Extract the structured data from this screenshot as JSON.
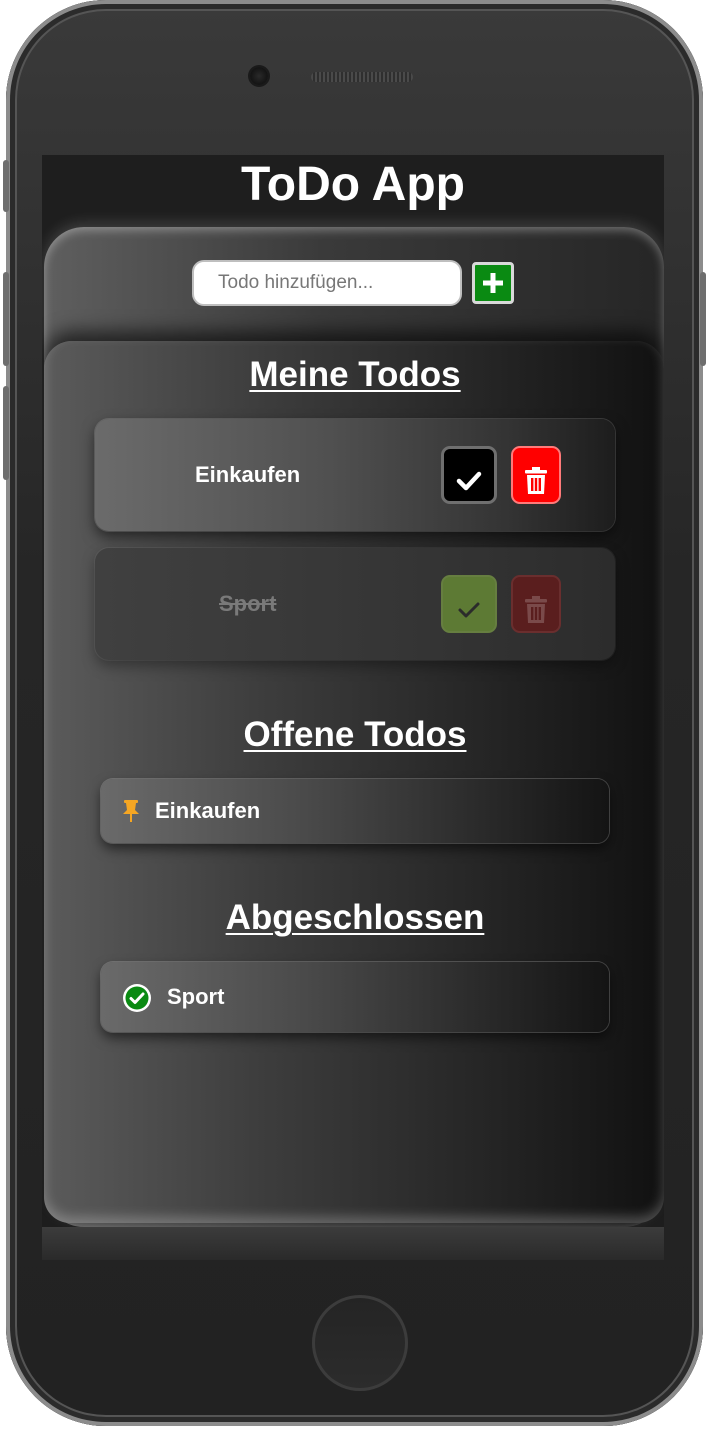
{
  "app": {
    "title": "ToDo App"
  },
  "add_form": {
    "input_value": "",
    "input_placeholder": "Todo hinzufügen...",
    "add_button_icon": "plus-icon",
    "add_button_color": "#0a8a12"
  },
  "sections": {
    "my_todos_title": "Meine Todos",
    "open_todos_title": "Offene Todos",
    "completed_title": "Abgeschlossen"
  },
  "todos": [
    {
      "label": "Einkaufen",
      "done": false
    },
    {
      "label": "Sport",
      "done": true
    }
  ],
  "open_todos": [
    {
      "label": "Einkaufen",
      "icon": "pin-icon",
      "icon_color": "#f5a623"
    }
  ],
  "completed_todos": [
    {
      "label": "Sport",
      "icon": "check-circle-icon",
      "icon_color": "#0a8a12"
    }
  ],
  "colors": {
    "delete": "#ff0000",
    "check": "#000000",
    "check_done": "#5d7a34"
  }
}
